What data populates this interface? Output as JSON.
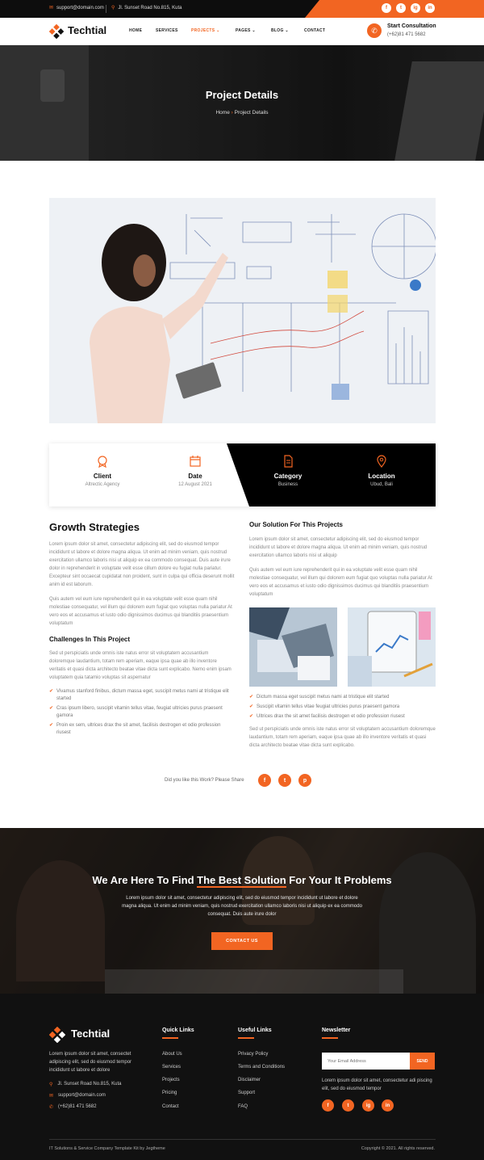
{
  "topbar": {
    "email": "support@domain.com",
    "address": "Jl. Sunset Road No.815, Kuta",
    "social": [
      "f",
      "t",
      "ig",
      "in"
    ]
  },
  "nav": {
    "brand": "Techtial",
    "items": [
      "HOME",
      "SERVICES",
      "PROJECTS",
      "PAGES",
      "BLOG",
      "CONTACT"
    ],
    "active": "PROJECTS",
    "consult_title": "Start Consultation",
    "consult_phone": "(+62)81 471 5682"
  },
  "banner": {
    "title": "Project Details",
    "crumb_home": "Home",
    "crumb_sep": "›",
    "crumb_current": "Project Details"
  },
  "info": {
    "client_label": "Client",
    "client_value": "Altrectic Agency",
    "date_label": "Date",
    "date_value": "12 August 2021",
    "category_label": "Category",
    "category_value": "Business",
    "location_label": "Location",
    "location_value": "Ubud, Bali"
  },
  "left": {
    "title": "Growth Strategies",
    "p1": "Lorem ipsum dolor sit amet, consectetur adipiscing elit, sed do eiusmod tempor incididunt ut labore et dolore magna aliqua. Ut enim ad minim veniam, quis nostrud exercitation ullamco laboris nisi ut aliquip ex ea commodo consequat. Duis aute irure dolor in reprehenderit in voluptate velit esse cillum dolore eu fugiat nulla pariatur. Excepteur sint occaecat cupidatat non proident, sunt in culpa qui officia deserunt mollit anim id est laborum.",
    "p2": "Quis autem vel eum iure reprehenderit qui in ea voluptate velit esse quam nihil molestiae consequatur, vel illum qui dolorem eum fugiat quo voluptas nulla pariatur At vero eos et accusamus et iusto odio dignissimos ducimus qui blanditiis praesentium voluptatum",
    "sub": "Challenges In This Project",
    "p3": "Sed ut perspiciatis unde omnis iste natus error sit voluptatem accusantium doloremque laudantium, totam rem aperiam, eaque ipsa quae ab illo inventore veritatis et quasi dicta architecto beatae vitae dicta sunt explicabo. Nemo enim ipsam voluptatem quia tatamio voluptas sit aspernatur",
    "bullets": [
      "Vivamus stanford finibus, dictum massa eget, suscipit metus nami at tristique elit started",
      "Cras ipsum libero, suscipit vitamin tellus vitae, feugiat ultricies purus praesent gamora",
      "Proin ex sem, ultrices drax the sit amet, facilisis destrogen et odio profession riusest"
    ]
  },
  "right": {
    "title": "Our Solution For This Projects",
    "p1": "Lorem ipsum dolor sit amet, consectetur adipiscing elit, sed do eiusmod tempor incididunt ut labore et dolore magna aliqua. Ut enim ad minim veniam, quis nostrud exercitation ullamco laboris nisi ut aliquip",
    "p2": "Quis autem vel eum iure reprehenderit qui in ea voluptate velit esse quam nihil molestiae consequatur, vel illum qui dolorem eum fugiat quo voluptas nulla pariatur At vero eos et accusamus et iusto odio dignissimos ducimus qui blanditiis praesentium voluptatum",
    "bullets": [
      "Dictum massa eget suscipit metus nami at tristique elit started",
      "Suscipit vitamin tellus vitae feugiat ultricies purus praesent gamora",
      "Ultrices drax the sit amet facilisis destrogen et odio profession riusest"
    ],
    "p3": "Sed ut perspiciatis unde omnis iste natus error sit voluptatem accusantium doloremque laudantium, totam rem aperiam, eaque ipsa quae ab illo inventore veritatis et quasi dicta architecto beatae vitae dicta sunt explicabo."
  },
  "share": {
    "label": "Did you like this Work? Please Share",
    "icons": [
      "f",
      "t",
      "p"
    ]
  },
  "cta": {
    "title_a": "We Are Here To Find ",
    "title_b": "The Best Solution",
    "title_c": " For Your It Problems",
    "text": "Lorem ipsum dolor sit amet, consectetur adipiscing elit, sed do eiusmod tempor incididunt ut labore et dolore magna aliqua. Ut enim ad minim veniam, quis nostrud exercitation ullamco laboris nisi ut aliquip ex ea commodo consequat. Duis aute irure dolor",
    "button": "CONTACT US"
  },
  "footer": {
    "brand": "Techtial",
    "about": "Lorem ipsum dolor sit amet, consectet adipiscing elit, sed do eiusmod tempor incididunt ut labore et dolore",
    "address": "Jl. Sunset Road No.815, Kuta",
    "email": "support@domain.com",
    "phone": "(+62)81 471 5682",
    "quick_title": "Quick Links",
    "quick": [
      "About Us",
      "Services",
      "Projects",
      "Pricing",
      "Contact"
    ],
    "useful_title": "Useful Links",
    "useful": [
      "Privacy Policy",
      "Terms and Conditions",
      "Disclaimer",
      "Support",
      "FAQ"
    ],
    "news_title": "Newsletter",
    "news_placeholder": "Your Email Address",
    "news_button": "SEND",
    "news_text": "Lorem ipsum dolor sit amet, consectetur adi piscing elit, sed do eiusmod tempor",
    "social": [
      "f",
      "t",
      "ig",
      "in"
    ],
    "bottom_left": "IT Solutions & Service Company Template Kit by Jegtheme",
    "bottom_right": "Copyright © 2021. All rights reserved."
  },
  "colors": {
    "accent": "#f26522",
    "dark": "#111111"
  }
}
